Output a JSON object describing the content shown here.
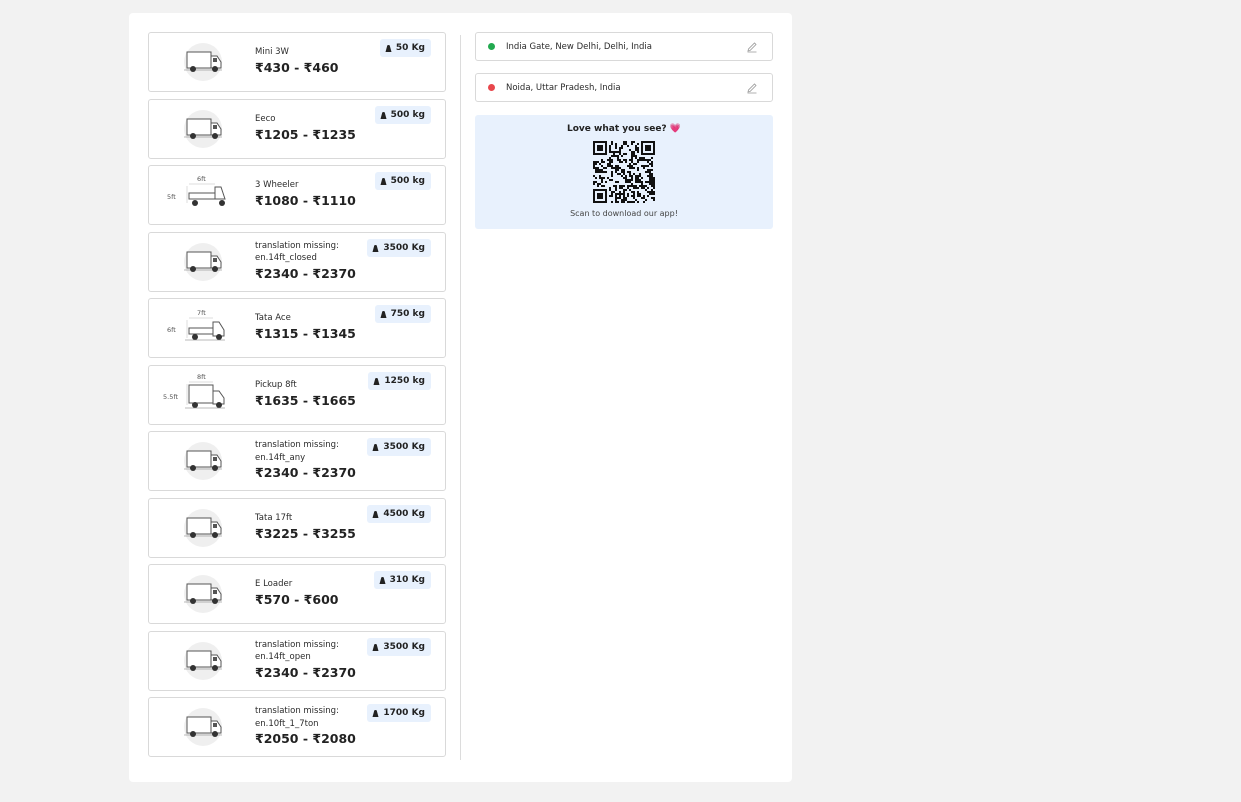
{
  "vehicles": [
    {
      "name": "Mini 3W",
      "price": "₹430 - ₹460",
      "capacity": "50 Kg",
      "image": "truck-closed"
    },
    {
      "name": "Eeco",
      "price": "₹1205 - ₹1235",
      "capacity": "500 kg",
      "image": "truck-closed"
    },
    {
      "name": "3 Wheeler",
      "price": "₹1080 - ₹1110",
      "capacity": "500 kg",
      "image": "three-wheeler-dim",
      "dim_w": "6ft",
      "dim_h": "5ft"
    },
    {
      "name": "translation missing: en.14ft_closed",
      "price": "₹2340 - ₹2370",
      "capacity": "3500 Kg",
      "image": "truck-closed"
    },
    {
      "name": "Tata Ace",
      "price": "₹1315 - ₹1345",
      "capacity": "750 kg",
      "image": "truck-open-dim",
      "dim_w": "7ft",
      "dim_h": "6ft"
    },
    {
      "name": "Pickup 8ft",
      "price": "₹1635 - ₹1665",
      "capacity": "1250 kg",
      "image": "truck-box-dim",
      "dim_w": "8ft",
      "dim_h": "5.5ft"
    },
    {
      "name": "translation missing: en.14ft_any",
      "price": "₹2340 - ₹2370",
      "capacity": "3500 Kg",
      "image": "truck-closed"
    },
    {
      "name": "Tata 17ft",
      "price": "₹3225 - ₹3255",
      "capacity": "4500 Kg",
      "image": "truck-closed"
    },
    {
      "name": "E Loader",
      "price": "₹570 - ₹600",
      "capacity": "310 Kg",
      "image": "truck-closed"
    },
    {
      "name": "translation missing: en.14ft_open",
      "price": "₹2340 - ₹2370",
      "capacity": "3500 Kg",
      "image": "truck-closed"
    },
    {
      "name": "translation missing: en.10ft_1_7ton",
      "price": "₹2050 - ₹2080",
      "capacity": "1700 Kg",
      "image": "truck-closed"
    }
  ],
  "locations": {
    "pickup": {
      "text": "India Gate, New Delhi, Delhi, India",
      "color": "#22a94f"
    },
    "drop": {
      "text": "Noida, Uttar Pradesh, India",
      "color": "#e8474c"
    }
  },
  "promo": {
    "title": "Love what you see? 💗",
    "subtitle": "Scan to download our app!"
  },
  "colors": {
    "accent_bg": "#e8f1fd",
    "border": "#d9d9d9"
  }
}
